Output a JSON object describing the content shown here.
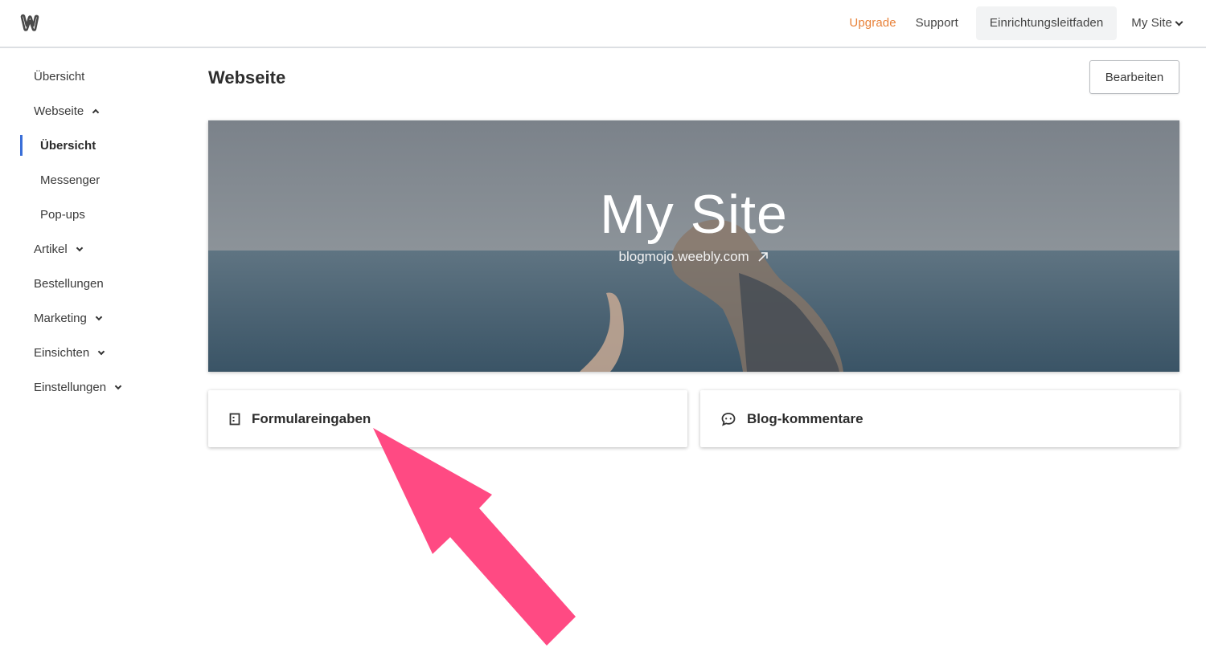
{
  "topbar": {
    "logo": "weebly-logo",
    "upgrade_label": "Upgrade",
    "support_label": "Support",
    "guide_label": "Einrichtungsleitfaden",
    "site_label": "My Site",
    "upgrade_color": "#e8823a"
  },
  "sidebar": {
    "items": [
      {
        "label": "Übersicht"
      },
      {
        "label": "Webseite"
      },
      {
        "label": "Übersicht"
      },
      {
        "label": "Messenger"
      },
      {
        "label": "Pop-ups"
      },
      {
        "label": "Artikel"
      },
      {
        "label": "Bestellungen"
      },
      {
        "label": "Marketing"
      },
      {
        "label": "Einsichten"
      },
      {
        "label": "Einstellungen"
      }
    ],
    "active_index": 2,
    "active_color": "#3a6fd8"
  },
  "main": {
    "title": "Webseite",
    "edit_label": "Bearbeiten",
    "hero": {
      "site_name": "My Site",
      "url": "blogmojo.weebly.com"
    },
    "cards": [
      {
        "label": "Formulareingaben",
        "icon": "form-icon"
      },
      {
        "label": "Blog-kommentare",
        "icon": "comment-icon"
      }
    ]
  },
  "annotation": {
    "arrow_color": "#ff4a83"
  }
}
